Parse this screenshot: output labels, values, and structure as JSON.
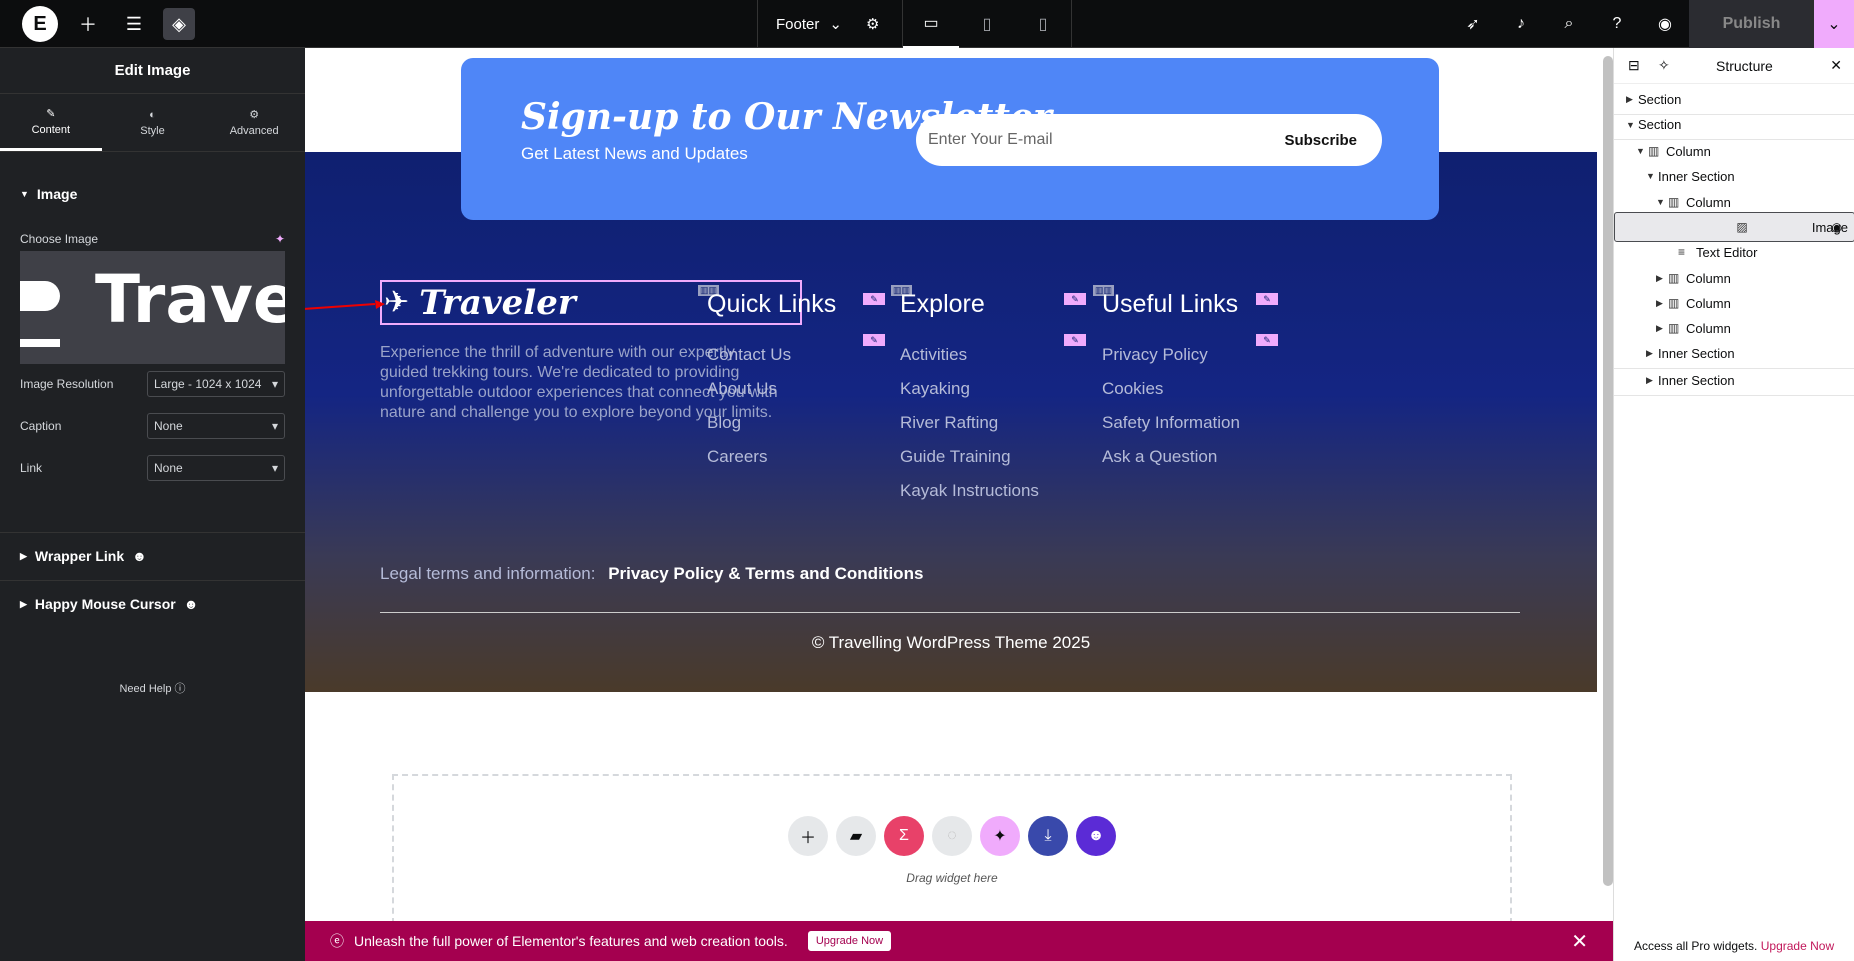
{
  "topbar": {
    "logo": "E",
    "doc_name": "Footer",
    "publish_label": "Publish"
  },
  "left_panel": {
    "title": "Edit Image",
    "tabs": [
      {
        "label": "Content",
        "icon": "pencil-icon"
      },
      {
        "label": "Style",
        "icon": "half-circle-icon"
      },
      {
        "label": "Advanced",
        "icon": "gear-icon"
      }
    ],
    "image_section": "Image",
    "choose_image_label": "Choose Image",
    "preview_text": "Travel",
    "resolution_label": "Image Resolution",
    "resolution_value": "Large - 1024 x 1024",
    "caption_label": "Caption",
    "caption_value": "None",
    "link_label": "Link",
    "link_value": "None",
    "wrapper_link": "Wrapper Link",
    "happy_cursor": "Happy Mouse Cursor",
    "need_help": "Need Help"
  },
  "canvas": {
    "newsletter": {
      "title": "Sign-up to Our Newsletter",
      "subtitle": "Get Latest News and Updates",
      "placeholder": "Enter Your E-mail",
      "button": "Subscribe"
    },
    "logo_text": "Traveler",
    "about_text": "Experience the thrill of adventure with our expertly guided trekking tours. We're dedicated to providing unforgettable outdoor experiences that connect you with nature and challenge you to explore beyond your limits.",
    "columns": [
      {
        "title": "Quick Links",
        "links": [
          "Contact Us",
          "About Us",
          "Blog",
          "Careers"
        ]
      },
      {
        "title": "Explore",
        "links": [
          "Activities",
          "Kayaking",
          "River Rafting",
          "Guide Training",
          "Kayak Instructions"
        ]
      },
      {
        "title": "Useful Links",
        "links": [
          "Privacy Policy",
          "Cookies",
          "Safety Information",
          "Ask a Question"
        ]
      }
    ],
    "legal_label": "Legal terms and information:",
    "legal_link": "Privacy Policy & Terms and Conditions",
    "copyright": "© Travelling WordPress Theme 2025",
    "drag_text": "Drag widget here",
    "upgrade_text": "Unleash the full power of Elementor's features and web creation tools.",
    "upgrade_button": "Upgrade Now"
  },
  "structure": {
    "title": "Structure",
    "items": [
      {
        "label": "Section",
        "depth": 0,
        "expanded": false
      },
      {
        "label": "Section",
        "depth": 0,
        "expanded": true
      },
      {
        "label": "Column",
        "depth": 1,
        "expanded": true
      },
      {
        "label": "Inner Section",
        "depth": 2,
        "expanded": true
      },
      {
        "label": "Column",
        "depth": 3,
        "expanded": true
      },
      {
        "label": "Image",
        "depth": 4,
        "selected": true
      },
      {
        "label": "Text Editor",
        "depth": 4
      },
      {
        "label": "Column",
        "depth": 3,
        "expanded": false
      },
      {
        "label": "Column",
        "depth": 3,
        "expanded": false
      },
      {
        "label": "Column",
        "depth": 3,
        "expanded": false
      },
      {
        "label": "Inner Section",
        "depth": 2,
        "expanded": false
      },
      {
        "label": "Inner Section",
        "depth": 2,
        "expanded": false
      }
    ],
    "footer_text": "Access all Pro widgets.",
    "footer_link": "Upgrade Now"
  }
}
